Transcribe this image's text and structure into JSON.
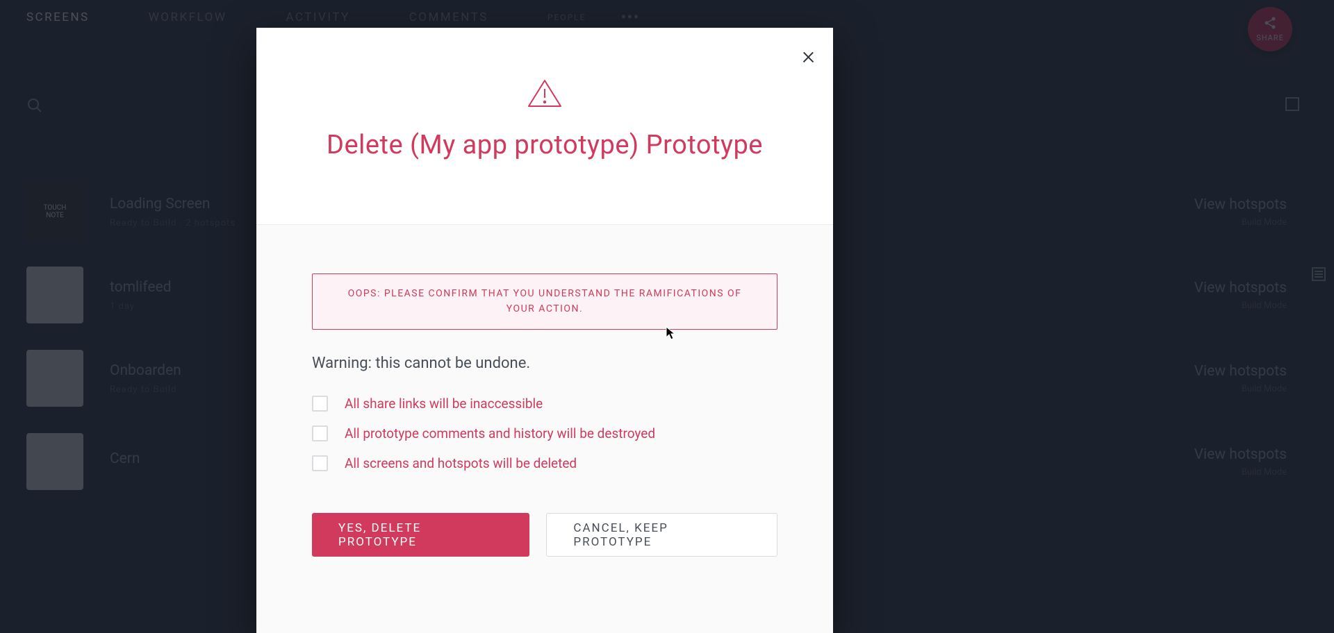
{
  "nav": {
    "tabs": [
      "SCREENS",
      "WORKFLOW",
      "ACTIVITY",
      "COMMENTS",
      "PEOPLE"
    ],
    "ellipsis": "•••",
    "share_label": "SHARE"
  },
  "screens": [
    {
      "title": "Loading Screen",
      "subtitle": "Ready to Build   ·   2 hotspots",
      "right_top": "View hotspots",
      "right_bottom": "Build Mode",
      "thumb_text": "TOUCH\nNOTE",
      "dark": true
    },
    {
      "title": "tomlifeed",
      "subtitle": "1 day",
      "right_top": "View hotspots",
      "right_bottom": "Build Mode",
      "thumb_text": "",
      "dark": false
    },
    {
      "title": "Onboarden",
      "subtitle": "Ready to Build",
      "right_top": "View hotspots",
      "right_bottom": "Build Mode",
      "thumb_text": "",
      "dark": false
    },
    {
      "title": "Cern",
      "subtitle": "",
      "right_top": "View hotspots",
      "right_bottom": "Build Mode",
      "thumb_text": "",
      "dark": false
    }
  ],
  "modal": {
    "title": "Delete (My app prototype) Prototype",
    "oops": "OOPS: PLEASE CONFIRM THAT YOU UNDERSTAND THE RAMIFICATIONS OF YOUR ACTION.",
    "subwarn": "Warning: this cannot be undone.",
    "checks": [
      "All share links will be inaccessible",
      "All prototype comments and history will be destroyed",
      "All screens and hotspots will be deleted"
    ],
    "confirm_label": "YES, DELETE PROTOTYPE",
    "cancel_label": "CANCEL, KEEP PROTOTYPE"
  }
}
